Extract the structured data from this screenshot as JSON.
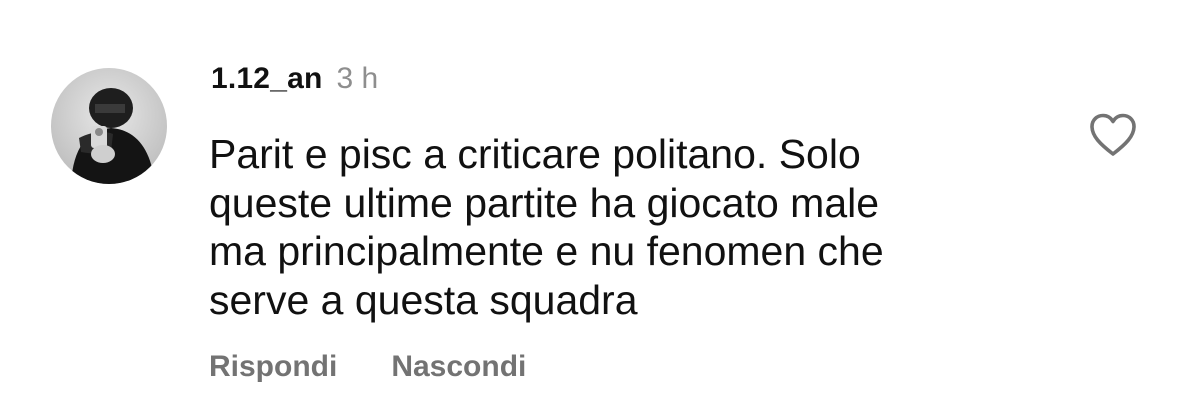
{
  "comment": {
    "username": "1.12_an",
    "timestamp": "3 h",
    "text_lines": [
      "Parit e pisc a criticare politano. Solo",
      "queste ultime partite ha giocato male",
      "ma principalmente e nu fenomen che",
      "serve a questa squadra"
    ],
    "actions": {
      "reply_label": "Rispondi",
      "hide_label": "Nascondi"
    },
    "like_icon": "heart-outline-icon"
  },
  "colors": {
    "text": "#111111",
    "muted": "#8e8e8e",
    "action": "#737373",
    "background": "#ffffff"
  }
}
